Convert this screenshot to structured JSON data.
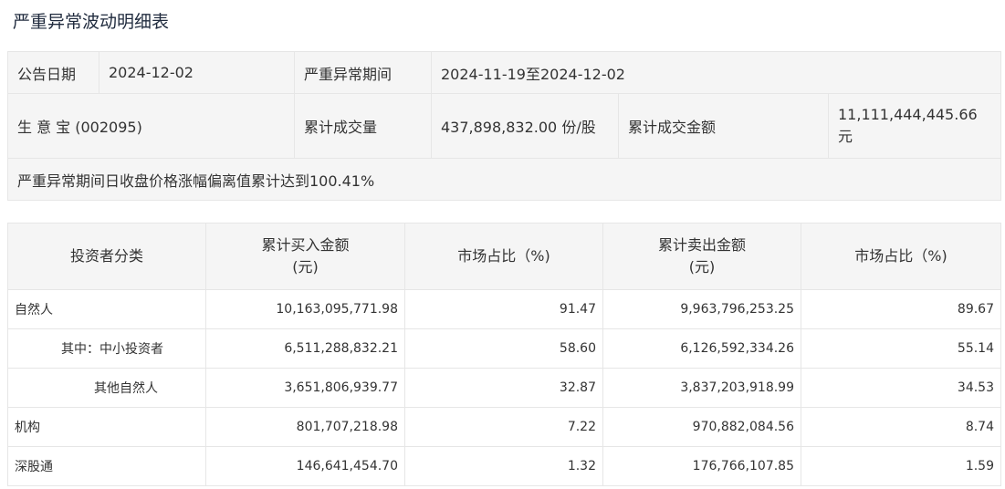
{
  "title": "严重异常波动明细表",
  "summary": {
    "announce_label": "公告日期",
    "announce_date": "2024-12-02",
    "period_label": "严重异常期间",
    "period_value": "2024-11-19至2024-12-02",
    "stock_name": "生 意 宝 (002095)",
    "volume_label": "累计成交量",
    "volume_value": "437,898,832.00 份/股",
    "amount_label": "累计成交金额",
    "amount_value": "11,111,444,445.66元",
    "deviation_note": "严重异常期间日收盘价格涨幅偏离值累计达到100.41%"
  },
  "detail": {
    "headers": {
      "category": "投资者分类",
      "buy_line1": "累计买入金额",
      "buy_line2": "(元)",
      "buy_share": "市场占比（%)",
      "sell_line1": "累计卖出金额",
      "sell_line2": "(元)",
      "sell_share": "市场占比（%)"
    },
    "rows": [
      {
        "category": "自然人",
        "buy": "10,163,095,771.98",
        "buy_share": "91.47",
        "sell": "9,963,796,253.25",
        "sell_share": "89.67"
      },
      {
        "category": "其中：中小投资者",
        "buy": "6,511,288,832.21",
        "buy_share": "58.60",
        "sell": "6,126,592,334.26",
        "sell_share": "55.14"
      },
      {
        "category": "其他自然人",
        "buy": "3,651,806,939.77",
        "buy_share": "32.87",
        "sell": "3,837,203,918.99",
        "sell_share": "34.53"
      },
      {
        "category": "机构",
        "buy": "801,707,218.98",
        "buy_share": "7.22",
        "sell": "970,882,084.56",
        "sell_share": "8.74"
      },
      {
        "category": "深股通",
        "buy": "146,641,454.70",
        "buy_share": "1.32",
        "sell": "176,766,107.85",
        "sell_share": "1.59"
      }
    ]
  }
}
